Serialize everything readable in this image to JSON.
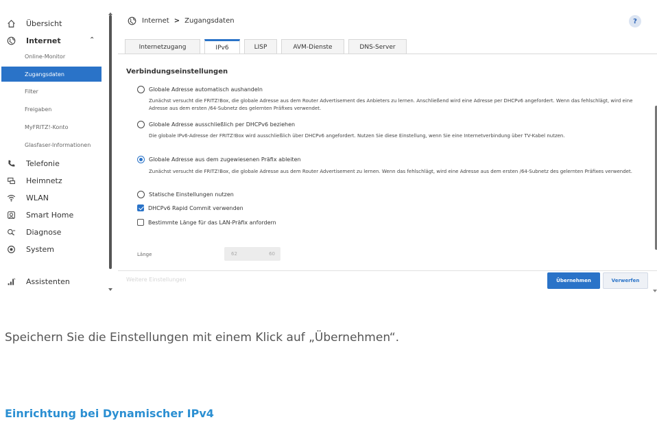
{
  "colors": {
    "accent": "#2a73c8",
    "heading": "#2b8fd2"
  },
  "sidebar": {
    "items": [
      {
        "label": "Übersicht",
        "icon": "home-icon"
      },
      {
        "label": "Internet",
        "icon": "globe-icon",
        "expanded": true
      },
      {
        "label": "Telefonie",
        "icon": "phone-icon"
      },
      {
        "label": "Heimnetz",
        "icon": "network-icon"
      },
      {
        "label": "WLAN",
        "icon": "wifi-icon"
      },
      {
        "label": "Smart Home",
        "icon": "smart-home-icon"
      },
      {
        "label": "Diagnose",
        "icon": "diagnose-icon"
      },
      {
        "label": "System",
        "icon": "system-icon"
      }
    ],
    "internet_subitems": [
      {
        "label": "Online-Monitor"
      },
      {
        "label": "Zugangsdaten",
        "active": true
      },
      {
        "label": "Filter"
      },
      {
        "label": "Freigaben"
      },
      {
        "label": "MyFRITZ!-Konto"
      },
      {
        "label": "Glasfaser-Informationen"
      }
    ],
    "assistant": {
      "label": "Assistenten",
      "icon": "assistant-icon"
    }
  },
  "breadcrumb": {
    "parent": "Internet",
    "separator": ">",
    "current": "Zugangsdaten"
  },
  "help_label": "?",
  "tabs": [
    "Internetzugang",
    "IPv6",
    "LISP",
    "AVM-Dienste",
    "DNS-Server"
  ],
  "active_tab": "IPv6",
  "section": {
    "title": "Verbindungseinstellungen",
    "options": [
      {
        "label": "Globale Adresse automatisch aushandeln",
        "selected": false,
        "description": "Zunächst versucht die FRITZ!Box, die globale Adresse aus dem Router Advertisement des Anbieters zu lernen. Anschließend wird eine Adresse per DHCPv6 angefordert. Wenn das fehlschlägt, wird eine Adresse aus dem ersten /64-Subnetz des gelernten Präfixes verwendet."
      },
      {
        "label": "Globale Adresse ausschließlich per DHCPv6 beziehen",
        "selected": false,
        "description": "Die globale IPv6-Adresse der FRITZ!Box wird ausschließlich über DHCPv6 angefordert. Nutzen Sie diese Einstellung, wenn Sie eine Internetverbindung über TV-Kabel nutzen."
      },
      {
        "label": "Globale Adresse aus dem zugewiesenen Präfix ableiten",
        "selected": true,
        "description": "Zunächst versucht die FRITZ!Box, die globale Adresse aus dem Router Advertisement zu lernen. Wenn das fehlschlägt, wird eine Adresse aus dem ersten /64-Subnetz des gelernten Präfixes verwendet."
      },
      {
        "label": "Statische Einstellungen nutzen",
        "selected": false
      }
    ],
    "checkboxes": [
      {
        "label": "DHCPv6 Rapid Commit verwenden",
        "checked": true
      },
      {
        "label": "Bestimmte Länge für das LAN-Präfix anfordern",
        "checked": false
      }
    ],
    "length": {
      "label": "Länge",
      "value": "62",
      "max": "60"
    }
  },
  "footer": {
    "more_settings": "Weitere Einstellungen",
    "apply": "Übernehmen",
    "discard": "Verwerfen"
  },
  "instruction": "Speichern Sie die Einstellungen mit einem Klick auf „Übernehmen“.",
  "heading": "Einrichtung bei Dynamischer IPv4"
}
